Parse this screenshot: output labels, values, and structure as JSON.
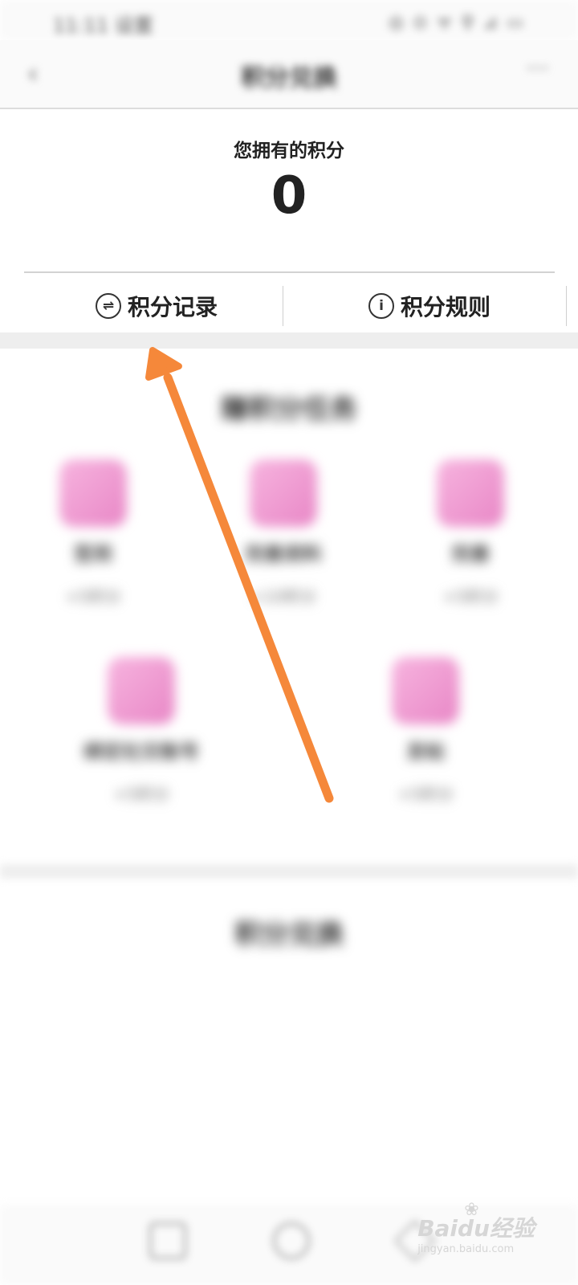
{
  "status_bar": {
    "time": "11:11 设置",
    "icons": "◎ ⊙ ᯤ ⚲ ⊿ ▭"
  },
  "header": {
    "back_icon": "chevron-left-icon",
    "title": "积分兑换",
    "more_icon": "more-dots-icon"
  },
  "summary": {
    "label": "您拥有的积分",
    "value": "0"
  },
  "actions": {
    "record_label": "积分记录",
    "record_icon_glyph": "⇌",
    "rules_label": "积分规则",
    "rules_icon_glyph": "i"
  },
  "tasks": {
    "title": "赚积分任务",
    "items": [
      {
        "name": "签到",
        "points": "+5积分",
        "icon": "gift-icon"
      },
      {
        "name": "完善资料",
        "points": "+10积分",
        "icon": "pencil-icon"
      },
      {
        "name": "完善",
        "points": "+5积分",
        "icon": "document-icon"
      },
      {
        "name": "绑定社交账号",
        "points": "+5积分",
        "icon": "checklist-icon"
      },
      {
        "name": "发帖",
        "points": "+5积分",
        "icon": "edit-icon"
      }
    ]
  },
  "mall": {
    "title": "积分兑换"
  },
  "bottom_nav": {
    "back_icon": "nav-back-icon",
    "home_icon": "nav-home-icon",
    "recent_icon": "nav-recent-icon"
  },
  "watermark": {
    "brand": "Baidu经验",
    "url": "jingyan.baidu.com"
  },
  "colors": {
    "arrow": "#f5883a",
    "task_icon": "#f0a3d4"
  }
}
